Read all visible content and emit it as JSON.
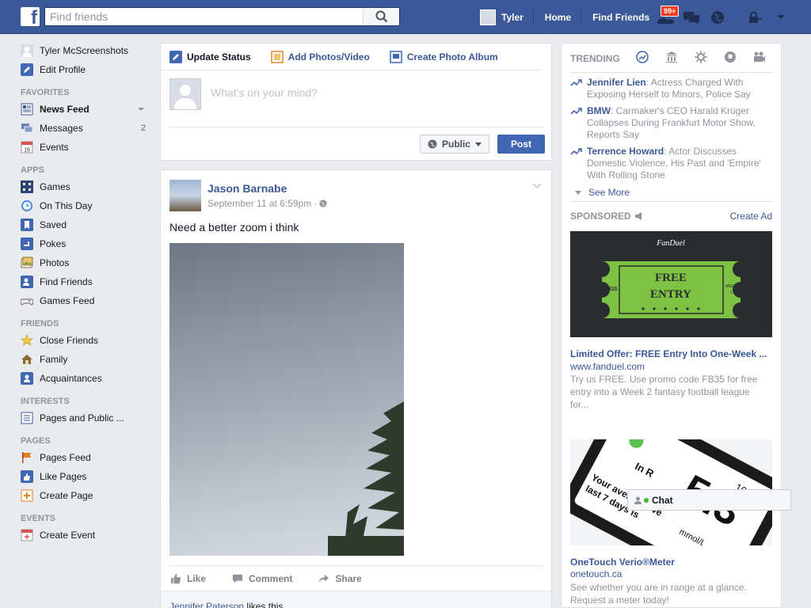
{
  "topbar": {
    "logo": "f",
    "search_placeholder": "Find friends",
    "user_name": "Tyler",
    "home_label": "Home",
    "find_friends_label": "Find Friends",
    "friend_requests_badge": "99+"
  },
  "sidebar": {
    "profile_name": "Tyler McScreenshots",
    "edit_profile": "Edit Profile",
    "favorites_header": "FAVORITES",
    "favorites": [
      {
        "label": "News Feed"
      },
      {
        "label": "Messages",
        "count": "2"
      },
      {
        "label": "Events"
      }
    ],
    "apps_header": "APPS",
    "apps": [
      {
        "label": "Games"
      },
      {
        "label": "On This Day"
      },
      {
        "label": "Saved"
      },
      {
        "label": "Pokes"
      },
      {
        "label": "Photos"
      },
      {
        "label": "Find Friends"
      },
      {
        "label": "Games Feed"
      }
    ],
    "friends_header": "FRIENDS",
    "friends": [
      {
        "label": "Close Friends"
      },
      {
        "label": "Family"
      },
      {
        "label": "Acquaintances"
      }
    ],
    "interests_header": "INTERESTS",
    "interests": [
      {
        "label": "Pages and Public ..."
      }
    ],
    "pages_header": "PAGES",
    "pages": [
      {
        "label": "Pages Feed"
      },
      {
        "label": "Like Pages"
      },
      {
        "label": "Create Page"
      }
    ],
    "events_header": "EVENTS",
    "events": [
      {
        "label": "Create Event"
      }
    ],
    "events_icon_text": "16"
  },
  "composer": {
    "tabs": [
      {
        "label": "Update Status"
      },
      {
        "label": "Add Photos/Video"
      },
      {
        "label": "Create Photo Album"
      }
    ],
    "placeholder": "What's on your mind?",
    "audience_label": "Public",
    "post_label": "Post"
  },
  "post": {
    "author": "Jason Barnabe",
    "timestamp": "September 11 at 6:59pm",
    "separator": "·",
    "text": "Need a better zoom i think",
    "actions": [
      {
        "label": "Like"
      },
      {
        "label": "Comment"
      },
      {
        "label": "Share"
      }
    ],
    "likes_name": "Jennifer Paterson",
    "likes_suffix": " likes this."
  },
  "trending": {
    "header": "TRENDING",
    "items": [
      {
        "name": "Jennifer Lien",
        "text": ": Actress Charged With Exposing Herself to Minors, Police Say"
      },
      {
        "name": "BMW",
        "text": ": Carmaker's CEO Harald Krüger Collapses During Frankfurt Motor Show, Reports Say"
      },
      {
        "name": "Terrence Howard",
        "text": ": Actor Discusses Domestic Violence, His Past and 'Empire' With Rolling Stone"
      }
    ],
    "see_more": "See More"
  },
  "sponsored": {
    "header": "SPONSORED",
    "create_ad": "Create Ad",
    "ad1": {
      "brand": "FanDuel",
      "ticket_line1": "FREE",
      "ticket_line2": "ENTRY",
      "ticket_left": "$$$$",
      "ticket_right_top": "WEEK",
      "ticket_right_bottom": "1",
      "title": "Limited Offer: FREE Entry Into One-Week ...",
      "url": "www.fanduel.com",
      "desc": "Try us FREE. Use promo code FB35 for free entry into a Week 2 fantasy football league for..."
    },
    "ad2": {
      "img_big": "5.3",
      "img_time": "10:30 am",
      "img_line1": "In R",
      "img_line2": "Your average ove",
      "img_line3": "last 7 days is",
      "img_unit": "mmol/L",
      "title": "OneTouch Verio®Meter",
      "url": "onetouch.ca",
      "desc": "See whether you are in range at a glance. Request a meter today!"
    }
  },
  "chat": {
    "label": "Chat"
  },
  "colors": {
    "brand": "#3b5998",
    "badge": "#f03d25",
    "fanduel_green": "#7dc243"
  }
}
